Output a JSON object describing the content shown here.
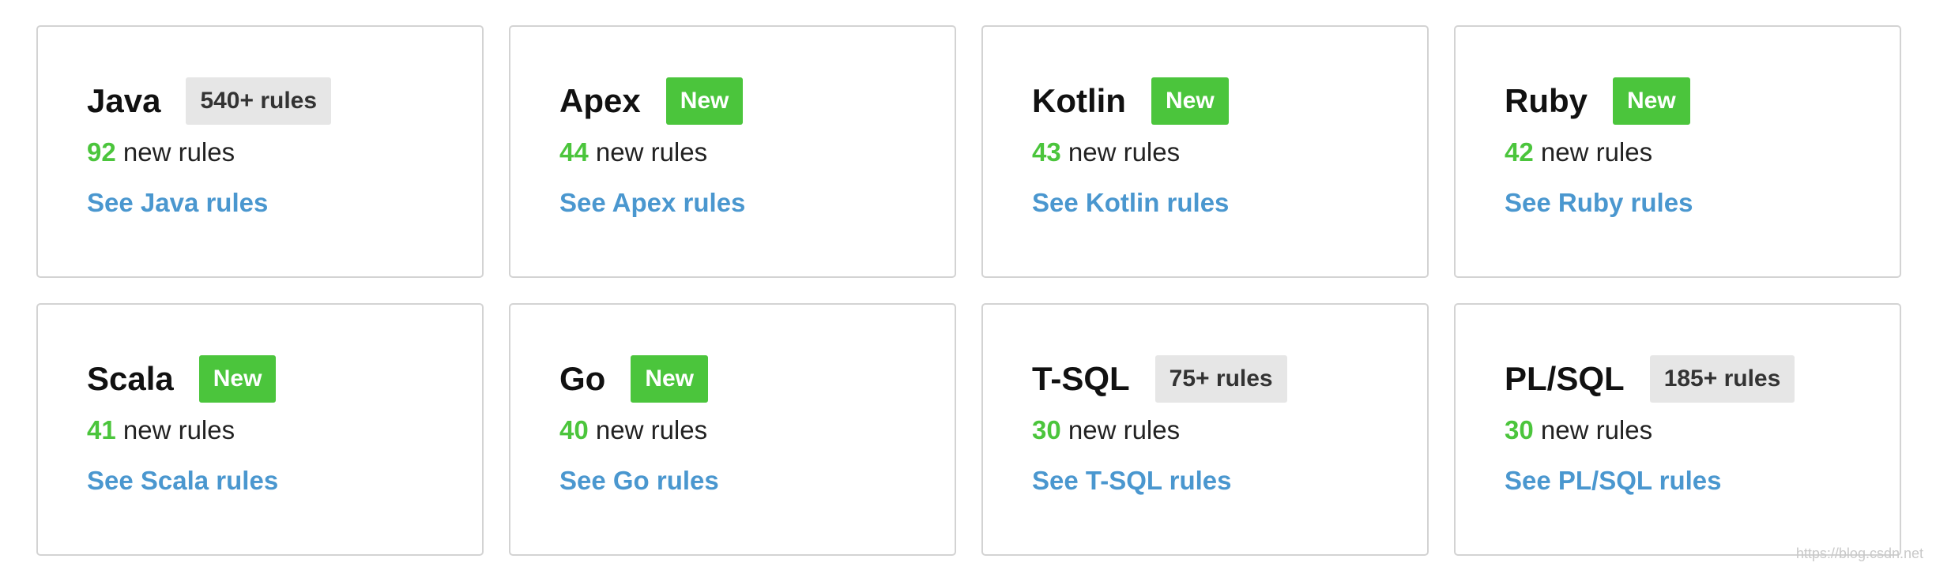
{
  "colors": {
    "accent_green": "#4bc53c",
    "link_blue": "#4a97cf",
    "badge_gray": "#e6e6e6",
    "border_gray": "#d3d3d3"
  },
  "cards": [
    {
      "name": "Java",
      "badge": "540+ rules",
      "badge_type": "count",
      "count": "92",
      "count_suffix": " new rules",
      "link": "See Java rules"
    },
    {
      "name": "Apex",
      "badge": "New",
      "badge_type": "new",
      "count": "44",
      "count_suffix": " new rules",
      "link": "See Apex rules"
    },
    {
      "name": "Kotlin",
      "badge": "New",
      "badge_type": "new",
      "count": "43",
      "count_suffix": " new rules",
      "link": "See Kotlin rules"
    },
    {
      "name": "Ruby",
      "badge": "New",
      "badge_type": "new",
      "count": "42",
      "count_suffix": " new rules",
      "link": "See Ruby rules"
    },
    {
      "name": "Scala",
      "badge": "New",
      "badge_type": "new",
      "count": "41",
      "count_suffix": " new rules",
      "link": "See Scala rules"
    },
    {
      "name": "Go",
      "badge": "New",
      "badge_type": "new",
      "count": "40",
      "count_suffix": " new rules",
      "link": "See Go rules"
    },
    {
      "name": "T-SQL",
      "badge": "75+ rules",
      "badge_type": "count",
      "count": "30",
      "count_suffix": " new rules",
      "link": "See T-SQL rules"
    },
    {
      "name": "PL/SQL",
      "badge": "185+ rules",
      "badge_type": "count",
      "count": "30",
      "count_suffix": " new rules",
      "link": "See PL/SQL rules"
    }
  ],
  "watermark": "https://blog.csdn.net"
}
